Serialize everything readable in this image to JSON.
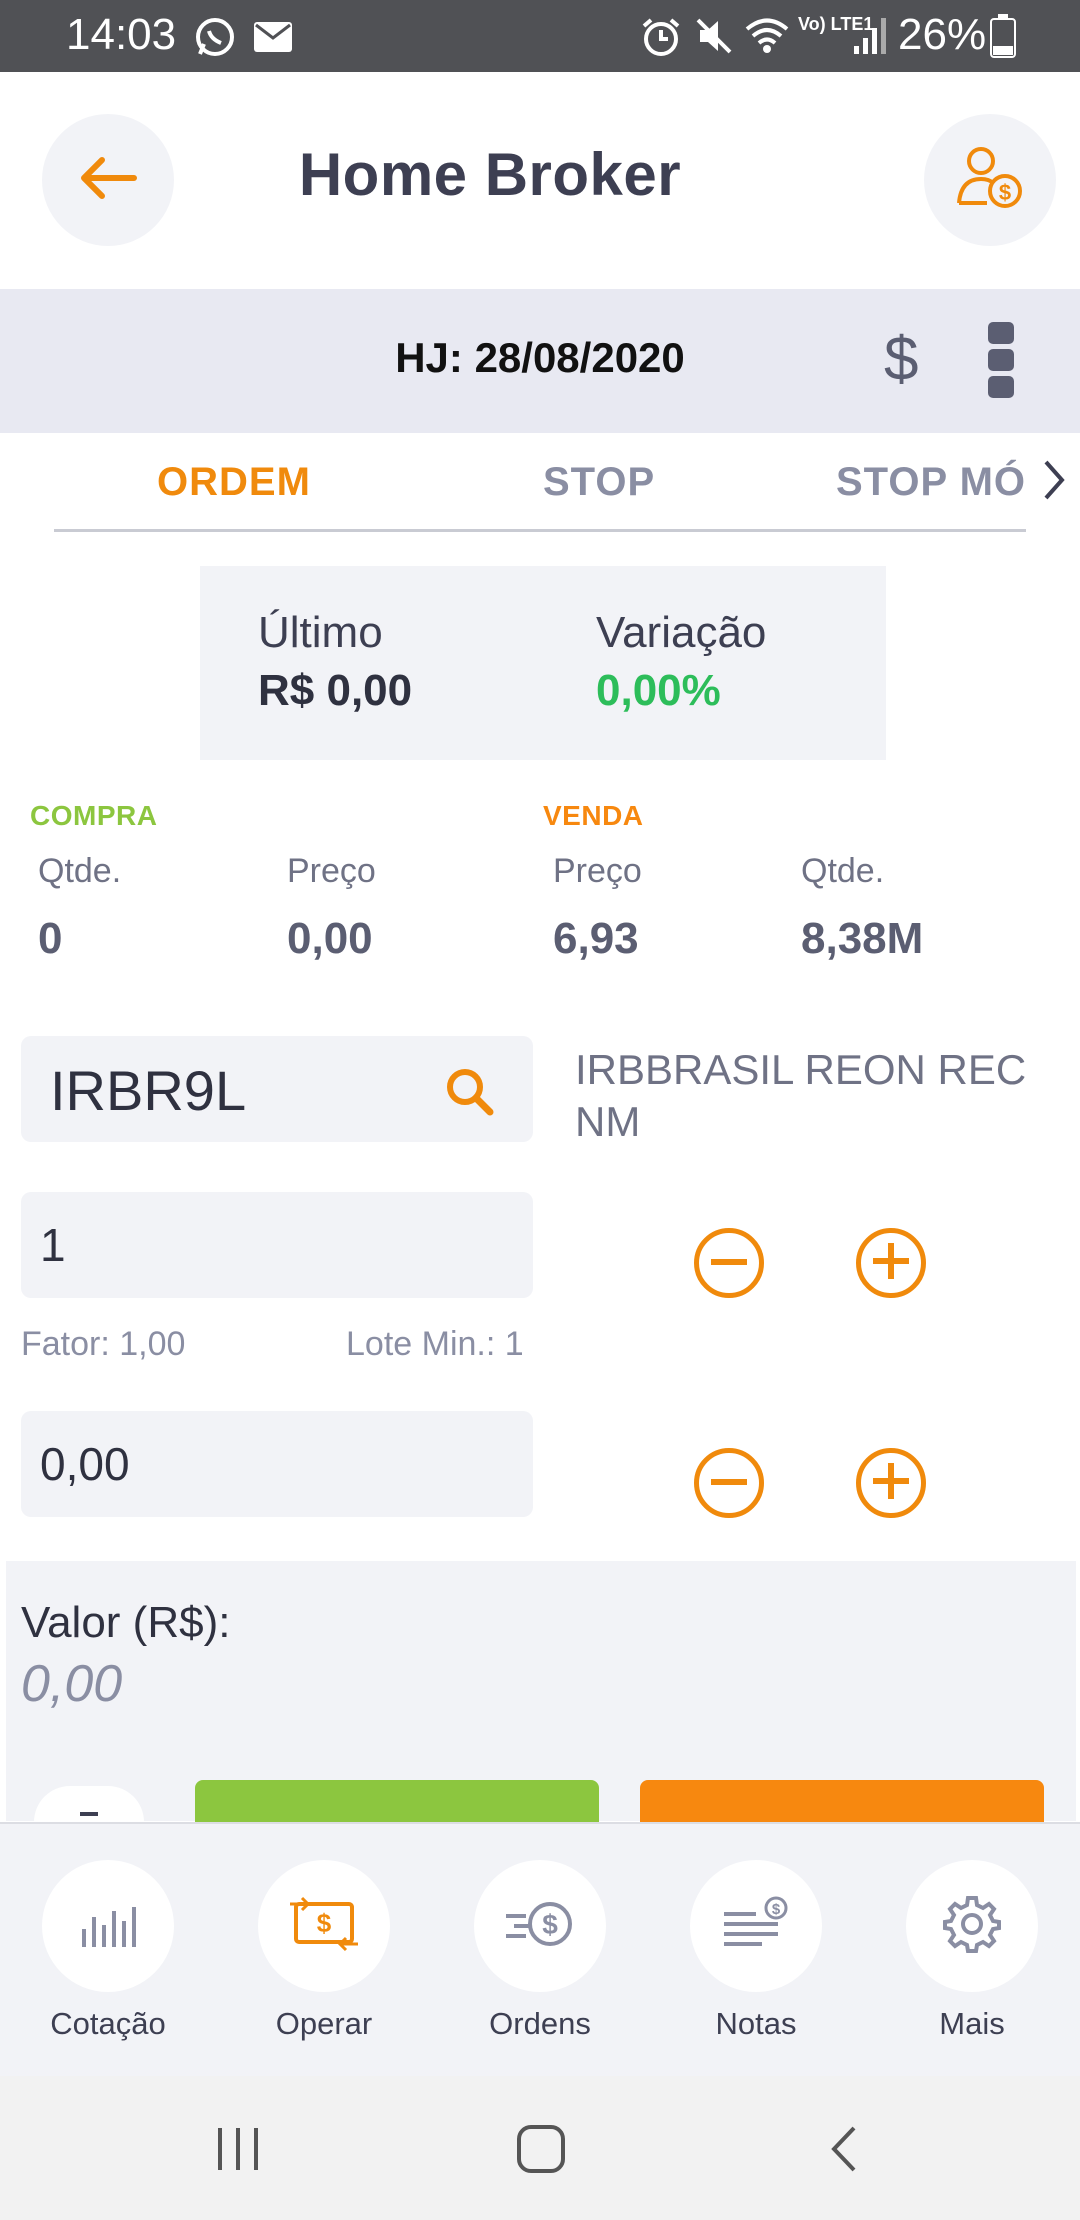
{
  "status_bar": {
    "time": "14:03",
    "battery": "26%",
    "lte": "Vo) LTE1",
    "icons": [
      "whatsapp-icon",
      "mail-icon",
      "alarm-icon",
      "mute-icon",
      "wifi-icon",
      "signal-icon",
      "battery-icon"
    ]
  },
  "header": {
    "title": "Home Broker",
    "back_icon": "arrow-left-icon",
    "account_icon": "user-money-icon"
  },
  "date_bar": {
    "date": "HJ: 28/08/2020",
    "currency_symbol": "$"
  },
  "tabs": [
    {
      "label": "ORDEM",
      "active": true
    },
    {
      "label": "STOP",
      "active": false
    },
    {
      "label": "STOP MÓVEL",
      "active": false
    }
  ],
  "quote": {
    "last_label": "Último",
    "last_value": "R$ 0,00",
    "variation_label": "Variação",
    "variation_value": "0,00%"
  },
  "book": {
    "buy_label": "COMPRA",
    "sell_label": "VENDA",
    "buy": {
      "qty_label": "Qtde.",
      "qty": "0",
      "price_label": "Preço",
      "price": "0,00"
    },
    "sell": {
      "price_label": "Preço",
      "price": "6,93",
      "qty_label": "Qtde.",
      "qty": "8,38M"
    }
  },
  "order_form": {
    "symbol": "IRBR9L",
    "company_name": "IRBBRASIL REON REC NM",
    "quantity": "1",
    "factor": "Fator: 1,00",
    "min_lot": "Lote Min.: 1",
    "price": "0,00",
    "total_label": "Valor (R$):",
    "total_value": "0,00",
    "colors": {
      "buy": "#8cc63f",
      "sell": "#f7880f",
      "accent": "#f08a0c",
      "positive": "#2dbd5a"
    }
  },
  "bottom_nav": [
    {
      "label": "Cotação",
      "icon": "bar-chart-icon"
    },
    {
      "label": "Operar",
      "icon": "exchange-money-icon",
      "active": true
    },
    {
      "label": "Ordens",
      "icon": "orders-money-icon"
    },
    {
      "label": "Notas",
      "icon": "notes-money-icon"
    },
    {
      "label": "Mais",
      "icon": "gear-icon"
    }
  ]
}
